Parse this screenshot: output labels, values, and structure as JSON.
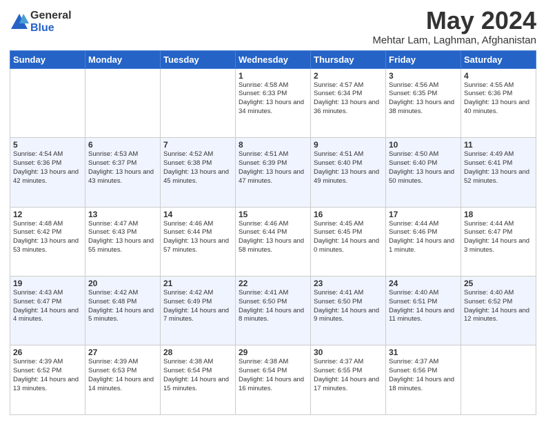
{
  "logo": {
    "general": "General",
    "blue": "Blue"
  },
  "header": {
    "title": "May 2024",
    "location": "Mehtar Lam, Laghman, Afghanistan"
  },
  "weekdays": [
    "Sunday",
    "Monday",
    "Tuesday",
    "Wednesday",
    "Thursday",
    "Friday",
    "Saturday"
  ],
  "weeks": [
    [
      {
        "day": "",
        "info": ""
      },
      {
        "day": "",
        "info": ""
      },
      {
        "day": "",
        "info": ""
      },
      {
        "day": "1",
        "info": "Sunrise: 4:58 AM\nSunset: 6:33 PM\nDaylight: 13 hours\nand 34 minutes."
      },
      {
        "day": "2",
        "info": "Sunrise: 4:57 AM\nSunset: 6:34 PM\nDaylight: 13 hours\nand 36 minutes."
      },
      {
        "day": "3",
        "info": "Sunrise: 4:56 AM\nSunset: 6:35 PM\nDaylight: 13 hours\nand 38 minutes."
      },
      {
        "day": "4",
        "info": "Sunrise: 4:55 AM\nSunset: 6:36 PM\nDaylight: 13 hours\nand 40 minutes."
      }
    ],
    [
      {
        "day": "5",
        "info": "Sunrise: 4:54 AM\nSunset: 6:36 PM\nDaylight: 13 hours\nand 42 minutes."
      },
      {
        "day": "6",
        "info": "Sunrise: 4:53 AM\nSunset: 6:37 PM\nDaylight: 13 hours\nand 43 minutes."
      },
      {
        "day": "7",
        "info": "Sunrise: 4:52 AM\nSunset: 6:38 PM\nDaylight: 13 hours\nand 45 minutes."
      },
      {
        "day": "8",
        "info": "Sunrise: 4:51 AM\nSunset: 6:39 PM\nDaylight: 13 hours\nand 47 minutes."
      },
      {
        "day": "9",
        "info": "Sunrise: 4:51 AM\nSunset: 6:40 PM\nDaylight: 13 hours\nand 49 minutes."
      },
      {
        "day": "10",
        "info": "Sunrise: 4:50 AM\nSunset: 6:40 PM\nDaylight: 13 hours\nand 50 minutes."
      },
      {
        "day": "11",
        "info": "Sunrise: 4:49 AM\nSunset: 6:41 PM\nDaylight: 13 hours\nand 52 minutes."
      }
    ],
    [
      {
        "day": "12",
        "info": "Sunrise: 4:48 AM\nSunset: 6:42 PM\nDaylight: 13 hours\nand 53 minutes."
      },
      {
        "day": "13",
        "info": "Sunrise: 4:47 AM\nSunset: 6:43 PM\nDaylight: 13 hours\nand 55 minutes."
      },
      {
        "day": "14",
        "info": "Sunrise: 4:46 AM\nSunset: 6:44 PM\nDaylight: 13 hours\nand 57 minutes."
      },
      {
        "day": "15",
        "info": "Sunrise: 4:46 AM\nSunset: 6:44 PM\nDaylight: 13 hours\nand 58 minutes."
      },
      {
        "day": "16",
        "info": "Sunrise: 4:45 AM\nSunset: 6:45 PM\nDaylight: 14 hours\nand 0 minutes."
      },
      {
        "day": "17",
        "info": "Sunrise: 4:44 AM\nSunset: 6:46 PM\nDaylight: 14 hours\nand 1 minute."
      },
      {
        "day": "18",
        "info": "Sunrise: 4:44 AM\nSunset: 6:47 PM\nDaylight: 14 hours\nand 3 minutes."
      }
    ],
    [
      {
        "day": "19",
        "info": "Sunrise: 4:43 AM\nSunset: 6:47 PM\nDaylight: 14 hours\nand 4 minutes."
      },
      {
        "day": "20",
        "info": "Sunrise: 4:42 AM\nSunset: 6:48 PM\nDaylight: 14 hours\nand 5 minutes."
      },
      {
        "day": "21",
        "info": "Sunrise: 4:42 AM\nSunset: 6:49 PM\nDaylight: 14 hours\nand 7 minutes."
      },
      {
        "day": "22",
        "info": "Sunrise: 4:41 AM\nSunset: 6:50 PM\nDaylight: 14 hours\nand 8 minutes."
      },
      {
        "day": "23",
        "info": "Sunrise: 4:41 AM\nSunset: 6:50 PM\nDaylight: 14 hours\nand 9 minutes."
      },
      {
        "day": "24",
        "info": "Sunrise: 4:40 AM\nSunset: 6:51 PM\nDaylight: 14 hours\nand 11 minutes."
      },
      {
        "day": "25",
        "info": "Sunrise: 4:40 AM\nSunset: 6:52 PM\nDaylight: 14 hours\nand 12 minutes."
      }
    ],
    [
      {
        "day": "26",
        "info": "Sunrise: 4:39 AM\nSunset: 6:52 PM\nDaylight: 14 hours\nand 13 minutes."
      },
      {
        "day": "27",
        "info": "Sunrise: 4:39 AM\nSunset: 6:53 PM\nDaylight: 14 hours\nand 14 minutes."
      },
      {
        "day": "28",
        "info": "Sunrise: 4:38 AM\nSunset: 6:54 PM\nDaylight: 14 hours\nand 15 minutes."
      },
      {
        "day": "29",
        "info": "Sunrise: 4:38 AM\nSunset: 6:54 PM\nDaylight: 14 hours\nand 16 minutes."
      },
      {
        "day": "30",
        "info": "Sunrise: 4:37 AM\nSunset: 6:55 PM\nDaylight: 14 hours\nand 17 minutes."
      },
      {
        "day": "31",
        "info": "Sunrise: 4:37 AM\nSunset: 6:56 PM\nDaylight: 14 hours\nand 18 minutes."
      },
      {
        "day": "",
        "info": ""
      }
    ]
  ]
}
